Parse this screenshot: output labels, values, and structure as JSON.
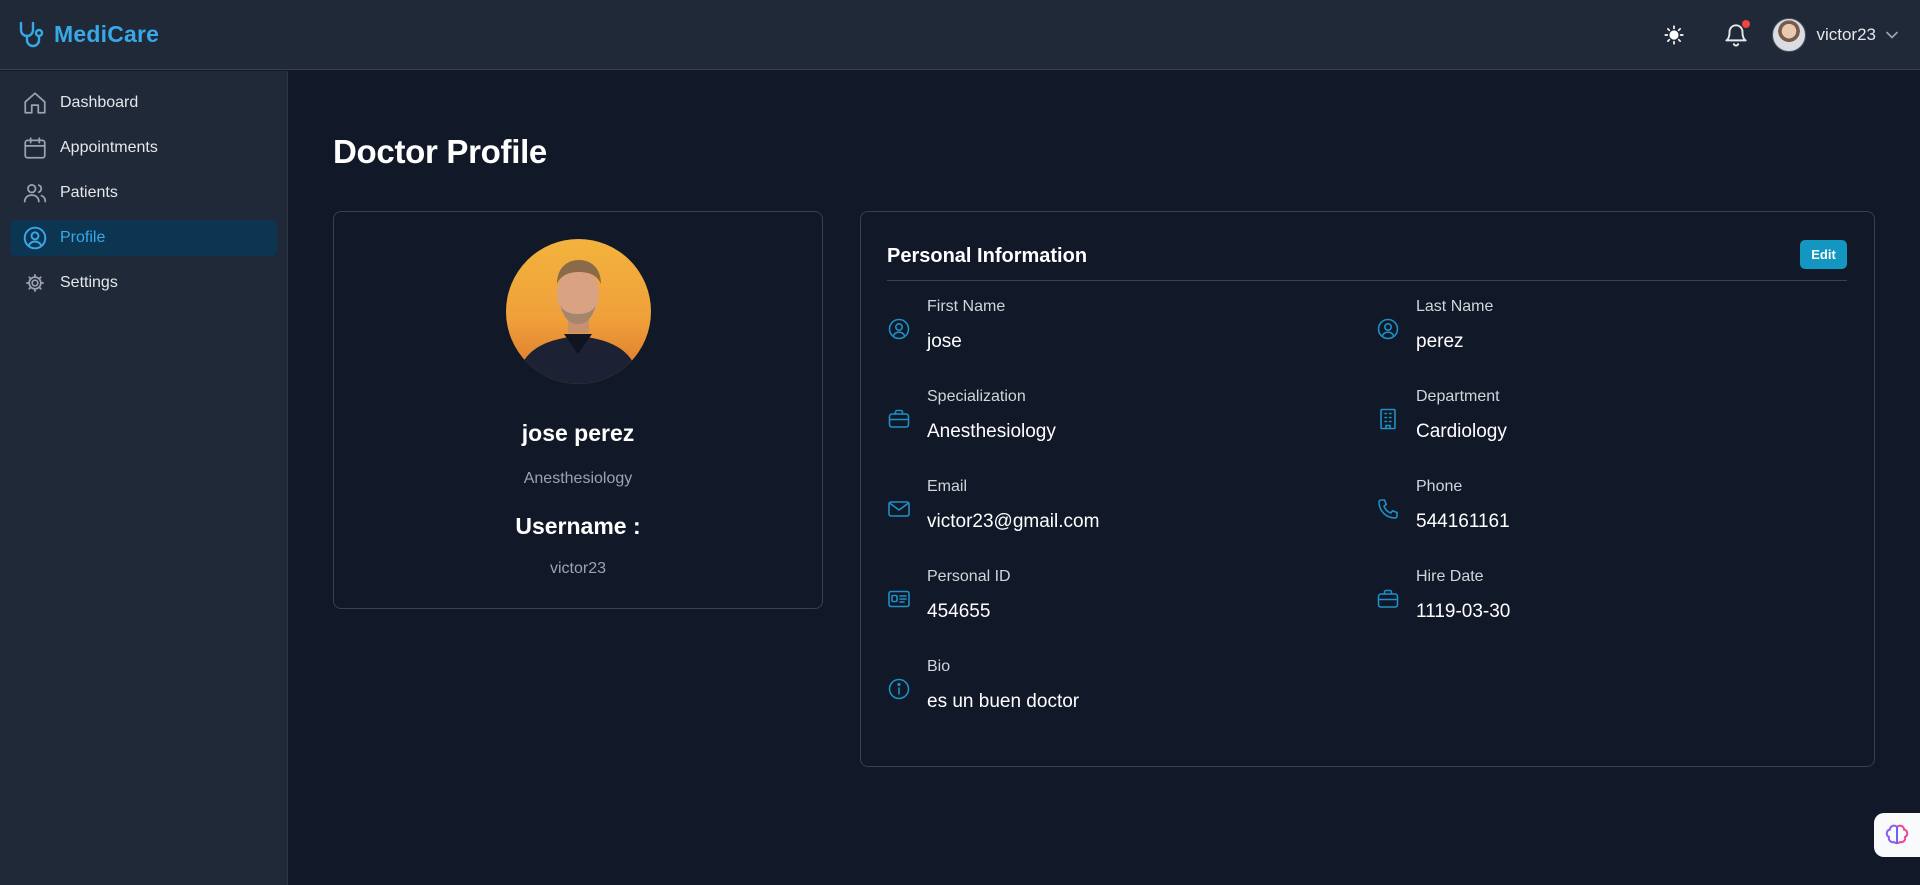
{
  "app": {
    "name": "MediCare"
  },
  "header": {
    "username": "victor23",
    "has_notification": true
  },
  "sidebar": {
    "items": [
      {
        "label": "Dashboard",
        "icon": "home-icon",
        "active": false
      },
      {
        "label": "Appointments",
        "icon": "calendar-icon",
        "active": false
      },
      {
        "label": "Patients",
        "icon": "users-icon",
        "active": false
      },
      {
        "label": "Profile",
        "icon": "user-circle-icon",
        "active": true
      },
      {
        "label": "Settings",
        "icon": "gear-icon",
        "active": false
      }
    ]
  },
  "page": {
    "title": "Doctor Profile"
  },
  "profile_card": {
    "full_name": "jose perez",
    "specialization": "Anesthesiology",
    "username_label": "Username :",
    "username": "victor23"
  },
  "personal_info": {
    "title": "Personal Information",
    "edit_label": "Edit",
    "fields": {
      "first_name": {
        "label": "First Name",
        "value": "jose",
        "icon": "user-circle-icon"
      },
      "last_name": {
        "label": "Last Name",
        "value": "perez",
        "icon": "user-circle-icon"
      },
      "specialization": {
        "label": "Specialization",
        "value": "Anesthesiology",
        "icon": "briefcase-icon"
      },
      "department": {
        "label": "Department",
        "value": "Cardiology",
        "icon": "building-icon"
      },
      "email": {
        "label": "Email",
        "value": "victor23@gmail.com",
        "icon": "mail-icon"
      },
      "phone": {
        "label": "Phone",
        "value": "544161161",
        "icon": "phone-icon"
      },
      "personal_id": {
        "label": "Personal ID",
        "value": "454655",
        "icon": "id-card-icon"
      },
      "hire_date": {
        "label": "Hire Date",
        "value": "1119-03-30",
        "icon": "briefcase-icon"
      },
      "bio": {
        "label": "Bio",
        "value": "es un buen doctor",
        "icon": "info-icon"
      }
    }
  },
  "colors": {
    "accent": "#38a8e6",
    "background": "#111827",
    "panel": "#1f2937",
    "active_nav_bg": "#0c3552",
    "edit_button": "#1396bf",
    "notification_dot": "#ef4444"
  }
}
